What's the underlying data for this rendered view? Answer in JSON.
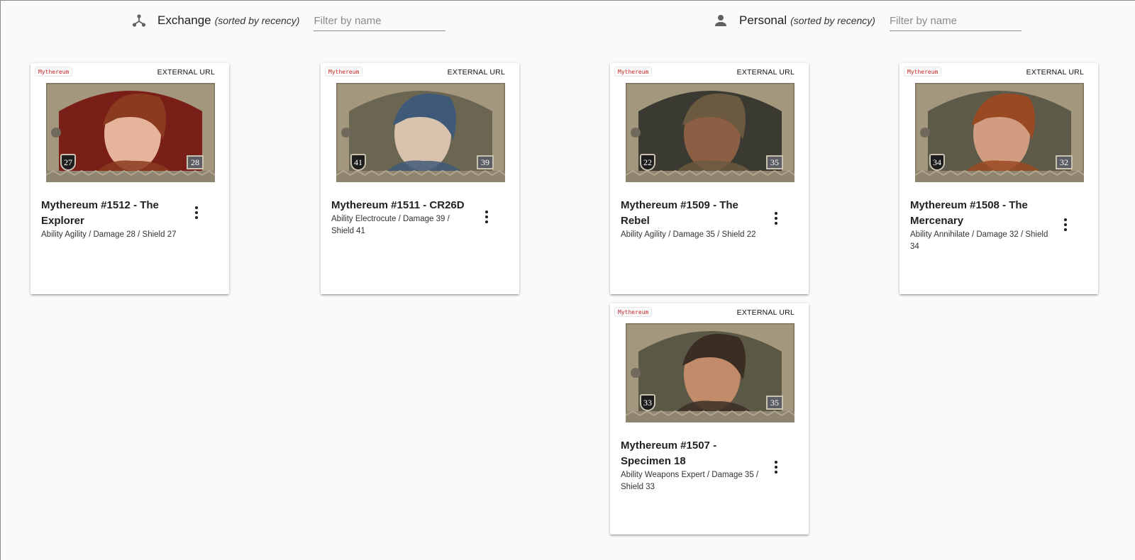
{
  "exchange": {
    "title": "Exchange",
    "sort_note": "(sorted by recency)",
    "filter_placeholder": "Filter by name",
    "icon": "share-network-icon"
  },
  "personal": {
    "title": "Personal",
    "sort_note": "(sorted by recency)",
    "filter_placeholder": "Filter by name",
    "icon": "person-icon"
  },
  "cards": [
    {
      "chip": "Mythereum",
      "external": "EXTERNAL URL",
      "title": "Mythereum #1512 - The Explorer",
      "subtitle": "Ability Agility / Damage 28 / Shield 27",
      "shield": "27",
      "damage": "28",
      "portrait_bg": "#7a1f17",
      "skin": "#e6b49a",
      "hair": "#8a3a1e"
    },
    {
      "chip": "Mythereum",
      "external": "EXTERNAL URL",
      "title": "Mythereum #1511 - CR26D",
      "subtitle": "Ability Electrocute / Damage 39 / Shield 41",
      "shield": "41",
      "damage": "39",
      "portrait_bg": "#6b6652",
      "skin": "#d9c2ad",
      "hair": "#3f5a78"
    },
    {
      "chip": "Mythereum",
      "external": "EXTERNAL URL",
      "title": "Mythereum #1509 - The Rebel",
      "subtitle": "Ability Agility / Damage 35 / Shield 22",
      "shield": "22",
      "damage": "35",
      "portrait_bg": "#3b3a32",
      "skin": "#8c5e43",
      "hair": "#6b5a3f"
    },
    {
      "chip": "Mythereum",
      "external": "EXTERNAL URL",
      "title": "Mythereum #1508 - The Mercenary",
      "subtitle": "Ability Annihilate / Damage 32 / Shield 34",
      "shield": "34",
      "damage": "32",
      "portrait_bg": "#5e5a4a",
      "skin": "#d19c80",
      "hair": "#9a4a22"
    },
    {
      "chip": "Mythereum",
      "external": "EXTERNAL URL",
      "title": "Mythereum #1507 - Specimen 18",
      "subtitle": "Ability Weapons Expert / Damage 35 / Shield 33",
      "shield": "33",
      "damage": "35",
      "portrait_bg": "#5c5846",
      "skin": "#c28b6a",
      "hair": "#3a2e24"
    }
  ]
}
